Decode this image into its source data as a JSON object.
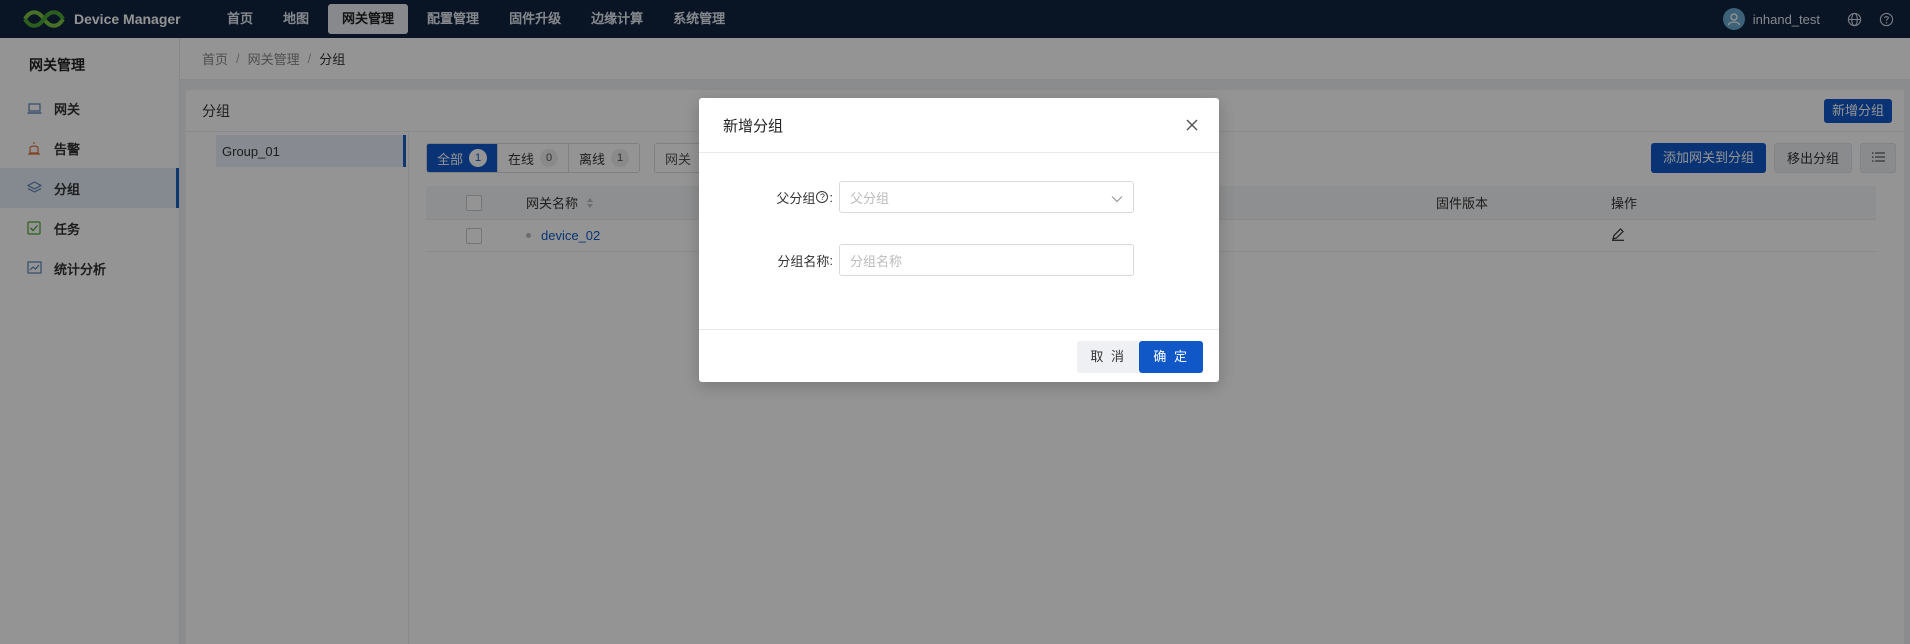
{
  "app": {
    "title": "Device Manager"
  },
  "nav": [
    {
      "label": "首页"
    },
    {
      "label": "地图"
    },
    {
      "label": "网关管理",
      "active": true
    },
    {
      "label": "配置管理"
    },
    {
      "label": "固件升级"
    },
    {
      "label": "边缘计算"
    },
    {
      "label": "系统管理"
    }
  ],
  "user": {
    "name": "inhand_test"
  },
  "sidebar": {
    "title": "网关管理",
    "items": [
      {
        "label": "网关",
        "icon": "laptop-icon"
      },
      {
        "label": "告警",
        "icon": "alarm-icon"
      },
      {
        "label": "分组",
        "icon": "layers-icon",
        "active": true
      },
      {
        "label": "任务",
        "icon": "task-icon"
      },
      {
        "label": "统计分析",
        "icon": "chart-icon"
      }
    ]
  },
  "breadcrumb": {
    "home": "首页",
    "section": "网关管理",
    "current": "分组"
  },
  "card": {
    "title": "分组",
    "add_group_label": "新增分组"
  },
  "groups": [
    {
      "label": "Group_01"
    }
  ],
  "filters": {
    "all": {
      "label": "全部",
      "count": "1"
    },
    "online": {
      "label": "在线",
      "count": "0"
    },
    "offline": {
      "label": "离线",
      "count": "1"
    },
    "search_label": "网关"
  },
  "toolbar": {
    "add_to_group_label": "添加网关到分组",
    "remove_label": "移出分组"
  },
  "table": {
    "columns": {
      "name": "网关名称",
      "firmware": "固件版本",
      "ops": "操作"
    },
    "rows": [
      {
        "name": "device_02"
      }
    ]
  },
  "modal": {
    "title": "新增分组",
    "parent_label": "父分组",
    "parent_placeholder": "父分组",
    "name_label": "分组名称",
    "name_placeholder": "分组名称",
    "cancel_label": "取 消",
    "ok_label": "确 定"
  },
  "colors": {
    "topbar": "#10233f",
    "primary": "#1058c8",
    "overlay": "rgba(0,0,0,0.42)"
  }
}
